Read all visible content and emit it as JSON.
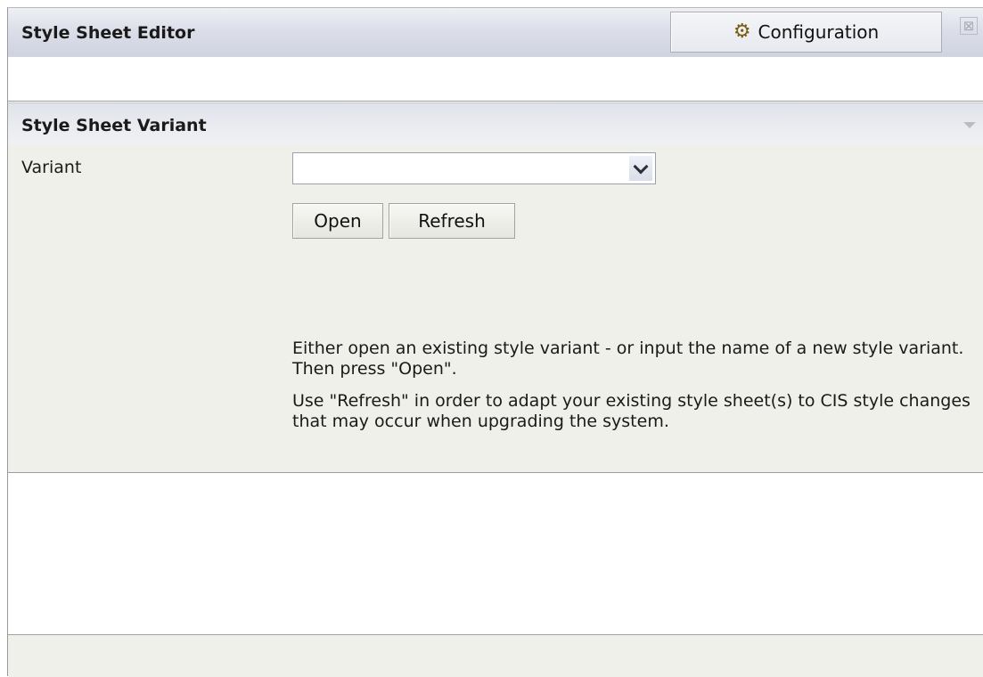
{
  "window": {
    "title": "Style Sheet Editor",
    "configuration_label": "Configuration",
    "configuration_icon": "gears-icon",
    "close_glyph": "⊠"
  },
  "section": {
    "title": "Style Sheet Variant",
    "variant_label": "Variant",
    "variant_value": "",
    "open_label": "Open",
    "refresh_label": "Refresh",
    "help_text_1": "Either open an existing style variant - or input the name of a new style variant. Then press \"Open\".",
    "help_text_2": "Use \"Refresh\" in order to adapt your existing style sheet(s) to CIS style changes that may occur when upgrading the system."
  },
  "colors": {
    "titlebar": "#dcdfe9",
    "section_body": "#f0f0ea",
    "border": "#9c9c9c"
  }
}
